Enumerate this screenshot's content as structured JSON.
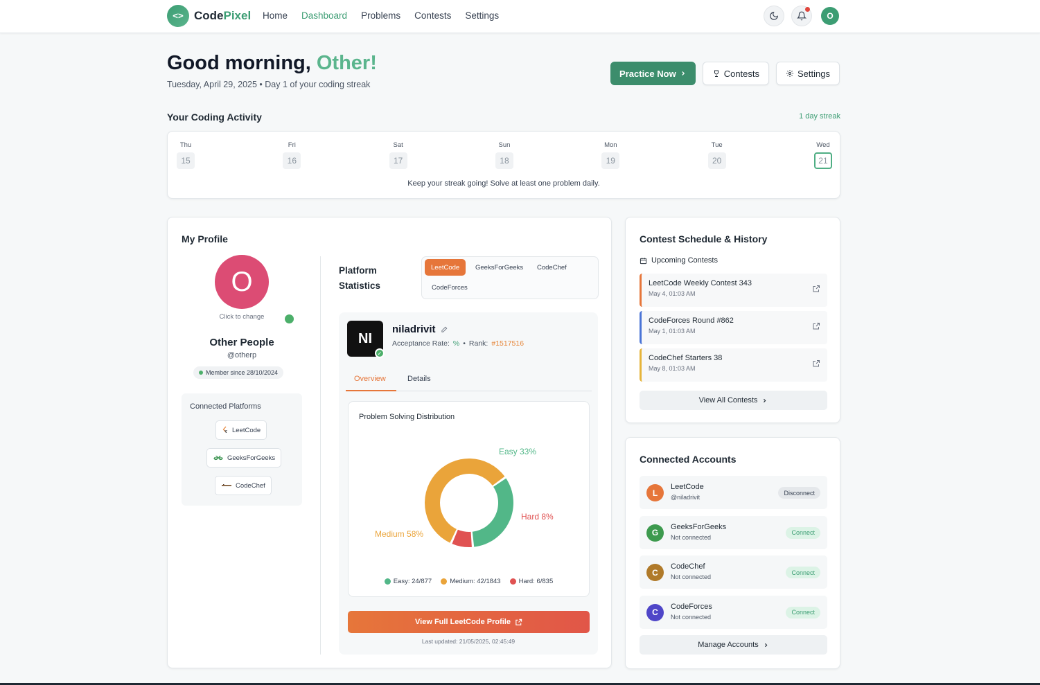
{
  "brand": {
    "prefix": "Code",
    "accent": "Pixel"
  },
  "nav": {
    "home": "Home",
    "dashboard": "Dashboard",
    "problems": "Problems",
    "contests": "Contests",
    "settings": "Settings"
  },
  "user_initial": "O",
  "greeting": {
    "prefix": "Good morning,",
    "name": "Other!",
    "subtitle": "Tuesday, April 29, 2025 • Day 1 of your coding streak"
  },
  "actions": {
    "practice": "Practice Now",
    "contests": "Contests",
    "settings": "Settings"
  },
  "activity": {
    "title": "Your Coding Activity",
    "streak": "1 day streak",
    "days": [
      {
        "name": "Thu",
        "num": "15"
      },
      {
        "name": "Fri",
        "num": "16"
      },
      {
        "name": "Sat",
        "num": "17"
      },
      {
        "name": "Sun",
        "num": "18"
      },
      {
        "name": "Mon",
        "num": "19"
      },
      {
        "name": "Tue",
        "num": "20"
      },
      {
        "name": "Wed",
        "num": "21"
      }
    ],
    "tip": "Keep your streak going! Solve at least one problem daily."
  },
  "profile": {
    "title": "My Profile",
    "avatar_initial": "O",
    "click_change": "Click to change",
    "name": "Other People",
    "handle": "@otherp",
    "member_since": "Member since 28/10/2024",
    "connected_title": "Connected Platforms",
    "connected": [
      "LeetCode",
      "GeeksForGeeks",
      "CodeChef"
    ]
  },
  "platform_stats": {
    "title_line1": "Platform",
    "title_line2": "Statistics",
    "tabs": [
      "LeetCode",
      "GeeksForGeeks",
      "CodeChef",
      "CodeForces"
    ],
    "avatar_text": "NI",
    "username": "niladrivit",
    "acceptance_label": "Acceptance Rate:",
    "acceptance_value": "%",
    "rank_label": "Rank:",
    "rank_value": "#1517516",
    "sub_tabs": [
      "Overview",
      "Details"
    ],
    "dist_title": "Problem Solving Distribution",
    "view_profile": "View Full LeetCode Profile",
    "last_updated": "Last updated: 21/05/2025, 02:45:49"
  },
  "chart_data": {
    "type": "pie",
    "title": "Problem Solving Distribution",
    "slices": [
      {
        "label": "Easy",
        "percent": 33,
        "color": "#52b788",
        "display": "Easy 33%",
        "legend": "Easy: 24/877"
      },
      {
        "label": "Hard",
        "percent": 8,
        "color": "#e05252",
        "display": "Hard 8%",
        "legend": "Hard: 6/835"
      },
      {
        "label": "Medium",
        "percent": 58,
        "color": "#eaa43a",
        "display": "Medium 58%",
        "legend": "Medium: 42/1843"
      }
    ]
  },
  "contests": {
    "title": "Contest Schedule & History",
    "upcoming": "Upcoming Contests",
    "items": [
      {
        "name": "LeetCode Weekly Contest 343",
        "date": "May 4, 01:03 AM",
        "color": "#e6763a"
      },
      {
        "name": "CodeForces Round #862",
        "date": "May 1, 01:03 AM",
        "color": "#4a74d6"
      },
      {
        "name": "CodeChef Starters 38",
        "date": "May 8, 01:03 AM",
        "color": "#e6b43a"
      }
    ],
    "view_all": "View All Contests"
  },
  "accounts": {
    "title": "Connected Accounts",
    "items": [
      {
        "initial": "L",
        "name": "LeetCode",
        "sub": "@niladrivit",
        "action": "Disconnect",
        "color": "#e6763a"
      },
      {
        "initial": "G",
        "name": "GeeksForGeeks",
        "sub": "Not connected",
        "action": "Connect",
        "color": "#3d9a4e"
      },
      {
        "initial": "C",
        "name": "CodeChef",
        "sub": "Not connected",
        "action": "Connect",
        "color": "#b07a2a"
      },
      {
        "initial": "C",
        "name": "CodeForces",
        "sub": "Not connected",
        "action": "Connect",
        "color": "#4f46c8"
      }
    ],
    "manage": "Manage Accounts"
  }
}
